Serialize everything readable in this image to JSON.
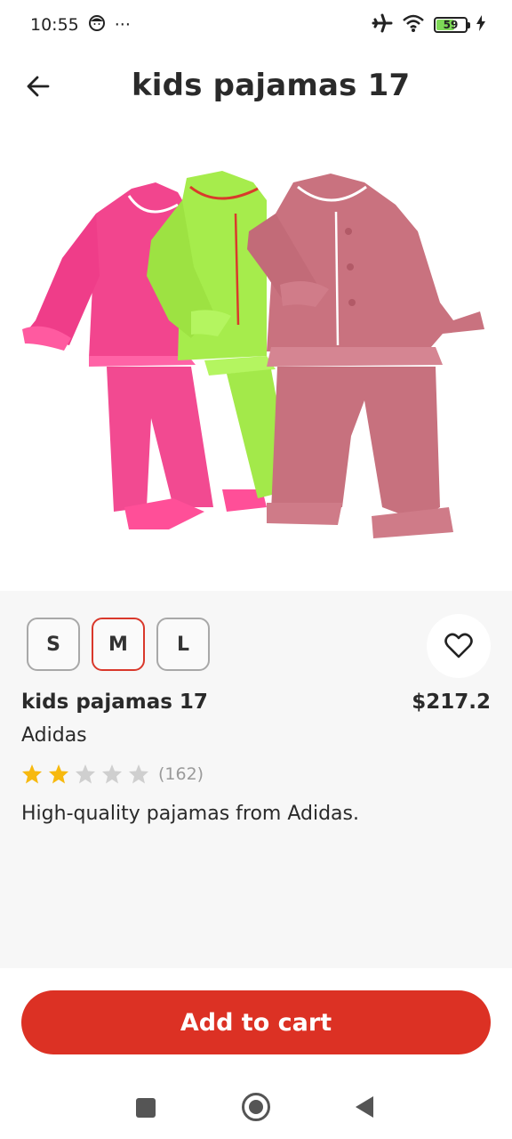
{
  "status_bar": {
    "time": "10:55",
    "dots": "···",
    "battery": "59",
    "battery_level": 0.59
  },
  "header": {
    "title": "kids pajamas 17"
  },
  "sizes": [
    "S",
    "M",
    "L"
  ],
  "selected_size": "M",
  "product": {
    "name": "kids pajamas 17",
    "price": "$217.2",
    "brand": "Adidas",
    "rating": 2,
    "rating_max": 5,
    "review_count": "(162)",
    "description": "High-quality pajamas from Adidas."
  },
  "cart": {
    "label": "Add to cart"
  },
  "colors": {
    "accent": "#dc3124",
    "star_filled": "#f7b90f",
    "star_empty": "#cfcfcf",
    "pajama_pink": "#f2458e",
    "pajama_green": "#a6ec4c",
    "pajama_mauve": "#c9727f"
  },
  "icons": {
    "back": "arrow-left-icon",
    "favorite": "heart-outline-icon",
    "airplane": "airplane-icon",
    "wifi": "wifi-icon",
    "charging": "bolt-icon"
  }
}
